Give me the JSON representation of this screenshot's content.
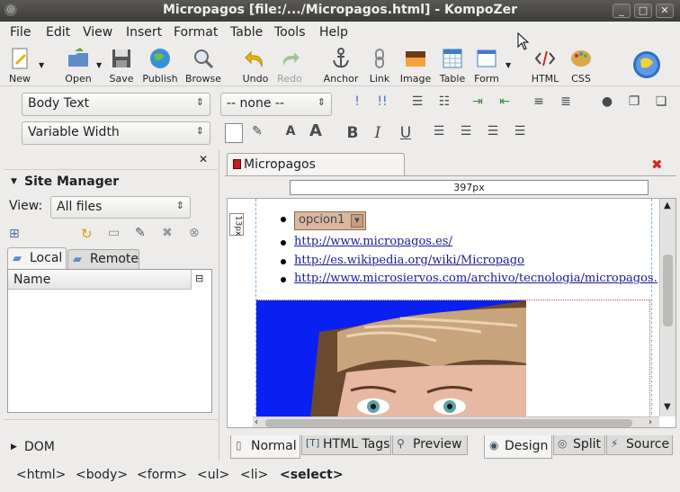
{
  "window": {
    "title": "Micropagos [file:/.../Micropagos.html] - KompoZer",
    "minimize": "_",
    "maximize": "□",
    "close": "✕"
  },
  "menu": [
    "File",
    "Edit",
    "View",
    "Insert",
    "Format",
    "Table",
    "Tools",
    "Help"
  ],
  "toolbar": {
    "new": "New",
    "open": "Open",
    "save": "Save",
    "publish": "Publish",
    "browse": "Browse",
    "undo": "Undo",
    "redo": "Redo",
    "anchor": "Anchor",
    "link": "Link",
    "image": "Image",
    "table": "Table",
    "form": "Form",
    "html": "HTML",
    "css": "CSS"
  },
  "format": {
    "paragraph": "Body Text",
    "class": "-- none --",
    "font": "Variable Width"
  },
  "site_manager": {
    "title": "Site Manager",
    "view_label": "View:",
    "view_value": "All files",
    "tab_local": "Local",
    "tab_remote": "Remote",
    "column_name": "Name",
    "dom_label": "DOM"
  },
  "document": {
    "tab_title": "Micropagos",
    "width_ruler": "397px",
    "height_ruler": "13px",
    "select_value": "opcion1",
    "links": [
      "http://www.micropagos.es/",
      "http://es.wikipedia.org/wiki/Micropago",
      "http://www.microsiervos.com/archivo/tecnologia/micropagos.htm"
    ]
  },
  "view_tabs": {
    "normal": "Normal",
    "html_tags": "HTML Tags",
    "preview": "Preview",
    "design": "Design",
    "split": "Split",
    "source": "Source"
  },
  "statusbar": [
    "<html>",
    "<body>",
    "<form>",
    "<ul>",
    "<li>",
    "<select>"
  ]
}
